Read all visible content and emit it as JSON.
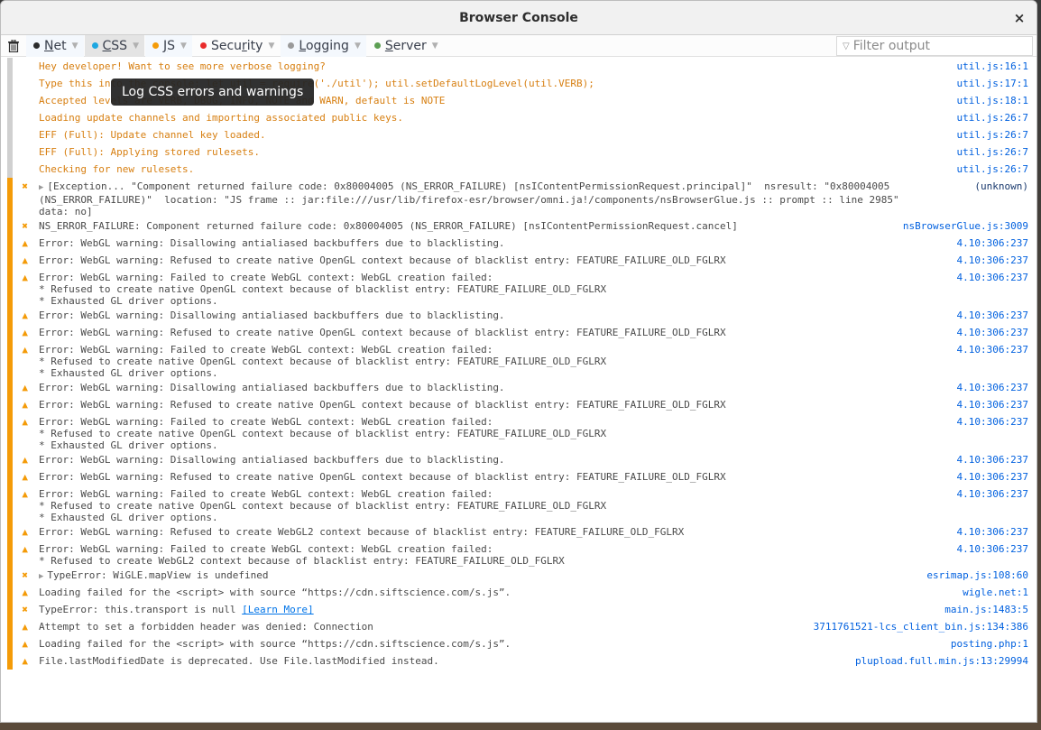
{
  "window": {
    "title": "Browser Console",
    "close_label": "×"
  },
  "toolbar": {
    "clear_icon": "trash-icon",
    "filters": [
      {
        "key": "net",
        "label": "Net",
        "dot_color": "#2b2b2b",
        "active": false,
        "accel": 0
      },
      {
        "key": "css",
        "label": "CSS",
        "dot_color": "#1ea7e1",
        "active": true,
        "accel": 0
      },
      {
        "key": "js",
        "label": "JS",
        "dot_color": "#f49b08",
        "active": false,
        "accel": 0
      },
      {
        "key": "security",
        "label": "Security",
        "dot_color": "#e92b2b",
        "active": false,
        "accel": 4
      },
      {
        "key": "logging",
        "label": "Logging",
        "dot_color": "#9a9a9a",
        "active": false,
        "accel": 0
      },
      {
        "key": "server",
        "label": "Server",
        "dot_color": "#5c9e52",
        "active": false,
        "accel": 0
      }
    ],
    "filter_placeholder": "Filter output",
    "filter_value": ""
  },
  "tooltip": {
    "text": "Log CSS errors and warnings"
  },
  "messages": [
    {
      "type": "log",
      "icon": "",
      "text": "Hey developer! Want to see more verbose logging?",
      "source": "util.js:16:1"
    },
    {
      "type": "log",
      "icon": "",
      "text": "Type this into the console: let util = require('./util'); util.setDefaultLogLevel(util.VERB);",
      "source": "util.js:17:1"
    },
    {
      "type": "log",
      "icon": "",
      "text": "Accepted levels are VERB, DBUG, INFO, NOTE and WARN, default is NOTE",
      "source": "util.js:18:1"
    },
    {
      "type": "log",
      "icon": "",
      "text": "Loading update channels and importing associated public keys.",
      "source": "util.js:26:7"
    },
    {
      "type": "log",
      "icon": "",
      "text": "EFF (Full): Update channel key loaded.",
      "source": "util.js:26:7"
    },
    {
      "type": "log",
      "icon": "",
      "text": "EFF (Full): Applying stored rulesets.",
      "source": "util.js:26:7"
    },
    {
      "type": "log",
      "icon": "",
      "text": "Checking for new rulesets.",
      "source": "util.js:26:7"
    },
    {
      "type": "err",
      "icon": "error",
      "expandable": true,
      "text": "[Exception... \"Component returned failure code: 0x80004005 (NS_ERROR_FAILURE) [nsIContentPermissionRequest.principal]\"  nsresult: \"0x80004005\n(NS_ERROR_FAILURE)\"  location: \"JS frame :: jar:file:///usr/lib/firefox-esr/browser/omni.ja!/components/nsBrowserGlue.js :: prompt :: line 2985\"\ndata: no]",
      "source": "(unknown)"
    },
    {
      "type": "err",
      "icon": "error",
      "text": "NS_ERROR_FAILURE: Component returned failure code: 0x80004005 (NS_ERROR_FAILURE) [nsIContentPermissionRequest.cancel]",
      "source": "nsBrowserGlue.js:3009"
    },
    {
      "type": "warn",
      "icon": "warning",
      "text": "Error: WebGL warning: Disallowing antialiased backbuffers due to blacklisting.",
      "source": "4.10:306:237"
    },
    {
      "type": "warn",
      "icon": "warning",
      "text": "Error: WebGL warning: Refused to create native OpenGL context because of blacklist entry: FEATURE_FAILURE_OLD_FGLRX",
      "source": "4.10:306:237"
    },
    {
      "type": "warn",
      "icon": "warning",
      "text": "Error: WebGL warning: Failed to create WebGL context: WebGL creation failed:\n* Refused to create native OpenGL context because of blacklist entry: FEATURE_FAILURE_OLD_FGLRX\n* Exhausted GL driver options.",
      "source": "4.10:306:237"
    },
    {
      "type": "warn",
      "icon": "warning",
      "text": "Error: WebGL warning: Disallowing antialiased backbuffers due to blacklisting.",
      "source": "4.10:306:237"
    },
    {
      "type": "warn",
      "icon": "warning",
      "text": "Error: WebGL warning: Refused to create native OpenGL context because of blacklist entry: FEATURE_FAILURE_OLD_FGLRX",
      "source": "4.10:306:237"
    },
    {
      "type": "warn",
      "icon": "warning",
      "text": "Error: WebGL warning: Failed to create WebGL context: WebGL creation failed:\n* Refused to create native OpenGL context because of blacklist entry: FEATURE_FAILURE_OLD_FGLRX\n* Exhausted GL driver options.",
      "source": "4.10:306:237"
    },
    {
      "type": "warn",
      "icon": "warning",
      "text": "Error: WebGL warning: Disallowing antialiased backbuffers due to blacklisting.",
      "source": "4.10:306:237"
    },
    {
      "type": "warn",
      "icon": "warning",
      "text": "Error: WebGL warning: Refused to create native OpenGL context because of blacklist entry: FEATURE_FAILURE_OLD_FGLRX",
      "source": "4.10:306:237"
    },
    {
      "type": "warn",
      "icon": "warning",
      "text": "Error: WebGL warning: Failed to create WebGL context: WebGL creation failed:\n* Refused to create native OpenGL context because of blacklist entry: FEATURE_FAILURE_OLD_FGLRX\n* Exhausted GL driver options.",
      "source": "4.10:306:237"
    },
    {
      "type": "warn",
      "icon": "warning",
      "text": "Error: WebGL warning: Disallowing antialiased backbuffers due to blacklisting.",
      "source": "4.10:306:237"
    },
    {
      "type": "warn",
      "icon": "warning",
      "text": "Error: WebGL warning: Refused to create native OpenGL context because of blacklist entry: FEATURE_FAILURE_OLD_FGLRX",
      "source": "4.10:306:237"
    },
    {
      "type": "warn",
      "icon": "warning",
      "text": "Error: WebGL warning: Failed to create WebGL context: WebGL creation failed:\n* Refused to create native OpenGL context because of blacklist entry: FEATURE_FAILURE_OLD_FGLRX\n* Exhausted GL driver options.",
      "source": "4.10:306:237"
    },
    {
      "type": "warn",
      "icon": "warning",
      "text": "Error: WebGL warning: Refused to create WebGL2 context because of blacklist entry: FEATURE_FAILURE_OLD_FGLRX",
      "source": "4.10:306:237"
    },
    {
      "type": "warn",
      "icon": "warning",
      "text": "Error: WebGL warning: Failed to create WebGL context: WebGL creation failed:\n* Refused to create WebGL2 context because of blacklist entry: FEATURE_FAILURE_OLD_FGLRX",
      "source": "4.10:306:237"
    },
    {
      "type": "err",
      "icon": "error",
      "expandable": true,
      "text": "TypeError: WiGLE.mapView is undefined",
      "source": "esrimap.js:108:60"
    },
    {
      "type": "warn",
      "icon": "warning",
      "text": "Loading failed for the <script> with source “https://cdn.siftscience.com/s.js”.",
      "source": "wigle.net:1"
    },
    {
      "type": "err",
      "icon": "error",
      "text": "TypeError: this.transport is null ",
      "link": "[Learn More]",
      "source": "main.js:1483:5"
    },
    {
      "type": "warn",
      "icon": "warning",
      "text": "Attempt to set a forbidden header was denied: Connection",
      "source": "3711761521-lcs_client_bin.js:134:386"
    },
    {
      "type": "warn",
      "icon": "warning",
      "text": "Loading failed for the <script> with source “https://cdn.siftscience.com/s.js”.",
      "source": "posting.php:1"
    },
    {
      "type": "warn",
      "icon": "warning",
      "text": "File.lastModifiedDate is deprecated. Use File.lastModified instead.",
      "source": "plupload.full.min.js:13:29994"
    }
  ]
}
